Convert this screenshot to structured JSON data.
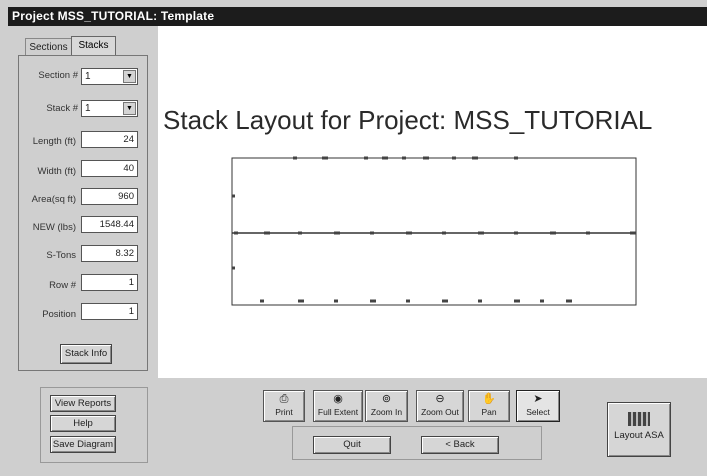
{
  "window": {
    "title": "Project MSS_TUTORIAL: Template"
  },
  "tabs": {
    "sections": "Sections",
    "stacks": "Stacks"
  },
  "fields": {
    "section_label": "Section #",
    "section_value": "1",
    "stack_label": "Stack #",
    "stack_value": "1",
    "length_label": "Length (ft)",
    "length_value": "24",
    "width_label": "Width (ft)",
    "width_value": "40",
    "area_label": "Area(sq ft)",
    "area_value": "960",
    "new_label": "NEW (lbs)",
    "new_value": "1548.44",
    "stons_label": "S-Tons",
    "stons_value": "8.32",
    "row_label": "Row #",
    "row_value": "1",
    "position_label": "Position",
    "position_value": "1"
  },
  "buttons": {
    "stack_info": "Stack Info",
    "view_reports": "View Reports",
    "help": "Help",
    "save_diagram": "Save Diagram",
    "quit": "Quit",
    "back": "< Back",
    "layout_asa": "Layout ASA"
  },
  "toolbar": {
    "print": "Print",
    "full_extent": "Full Extent",
    "zoom_in": "Zoom In",
    "zoom_out": "Zoom Out",
    "pan": "Pan",
    "select": "Select"
  },
  "diagram": {
    "heading": "Stack Layout for Project: MSS_TUTORIAL"
  }
}
